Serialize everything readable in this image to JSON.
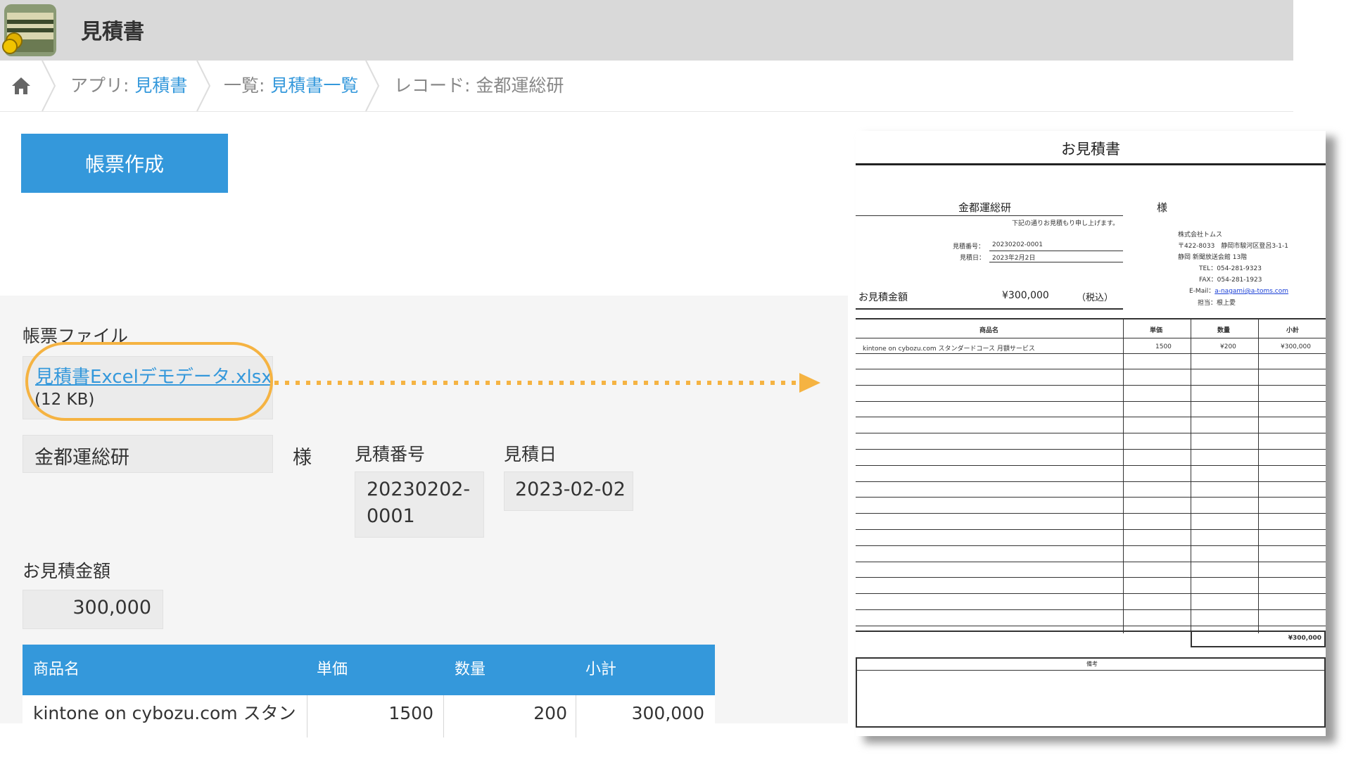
{
  "app": {
    "title": "見積書",
    "icon": "coin-stack-icon"
  },
  "breadcrumb": {
    "app_prefix": "アプリ: ",
    "app_link": "見積書",
    "list_prefix": "一覧: ",
    "list_link": "見積書一覧",
    "record": "レコード: 金都運総研"
  },
  "toolbar": {
    "create_label": "帳票作成"
  },
  "record": {
    "file_label": "帳票ファイル",
    "file_name": "見積書Excelデモデータ.xlsx",
    "file_size": "(12 KB)",
    "customer": "金都運総研",
    "honorific": "様",
    "quote_no_label": "見積番号",
    "quote_no_line1": "20230202-",
    "quote_no_line2": "0001",
    "quote_date_label": "見積日",
    "quote_date": "2023-02-02",
    "amount_label": "お見積金額",
    "amount": "300,000",
    "table": {
      "headers": [
        "商品名",
        "単価",
        "数量",
        "小計"
      ],
      "row": {
        "name": "kintone on cybozu.com スタン",
        "price": "1500",
        "qty": "200",
        "subtotal": "300,000"
      }
    }
  },
  "document": {
    "title": "お見積書",
    "customer": "金都運総研",
    "honorific": "様",
    "intro": "下記の通りお見積もり申し上げます。",
    "quote_no_label": "見積番号：",
    "quote_no": "20230202-0001",
    "quote_date_label": "見積日：",
    "quote_date": "2023年2月2日",
    "company": "株式会社トムス",
    "address1": "〒422-8033　静岡市駿河区登呂3-1-1",
    "address2": "静岡 新聞放送会館 13階",
    "tel": "TEL：054-281-9323",
    "fax": "FAX：054-281-1923",
    "email_label": "E-Mail：",
    "email": "a-nagami@a-toms.com",
    "staff": "担当：根上愛",
    "amount_label": "お見積金額",
    "amount": "¥300,000",
    "tax": "（税込）",
    "headers": [
      "商品名",
      "単価",
      "数量",
      "小計"
    ],
    "row": {
      "name": "kintone on cybozu.com スタンダードコース 月額サービス",
      "price": "1500",
      "qty": "¥200",
      "subtotal": "¥300,000"
    },
    "total": "¥300,000",
    "remarks_label": "備考"
  },
  "colors": {
    "accent": "#3498db",
    "highlight": "#f5b342",
    "header_bg": "#d9d9d9"
  }
}
